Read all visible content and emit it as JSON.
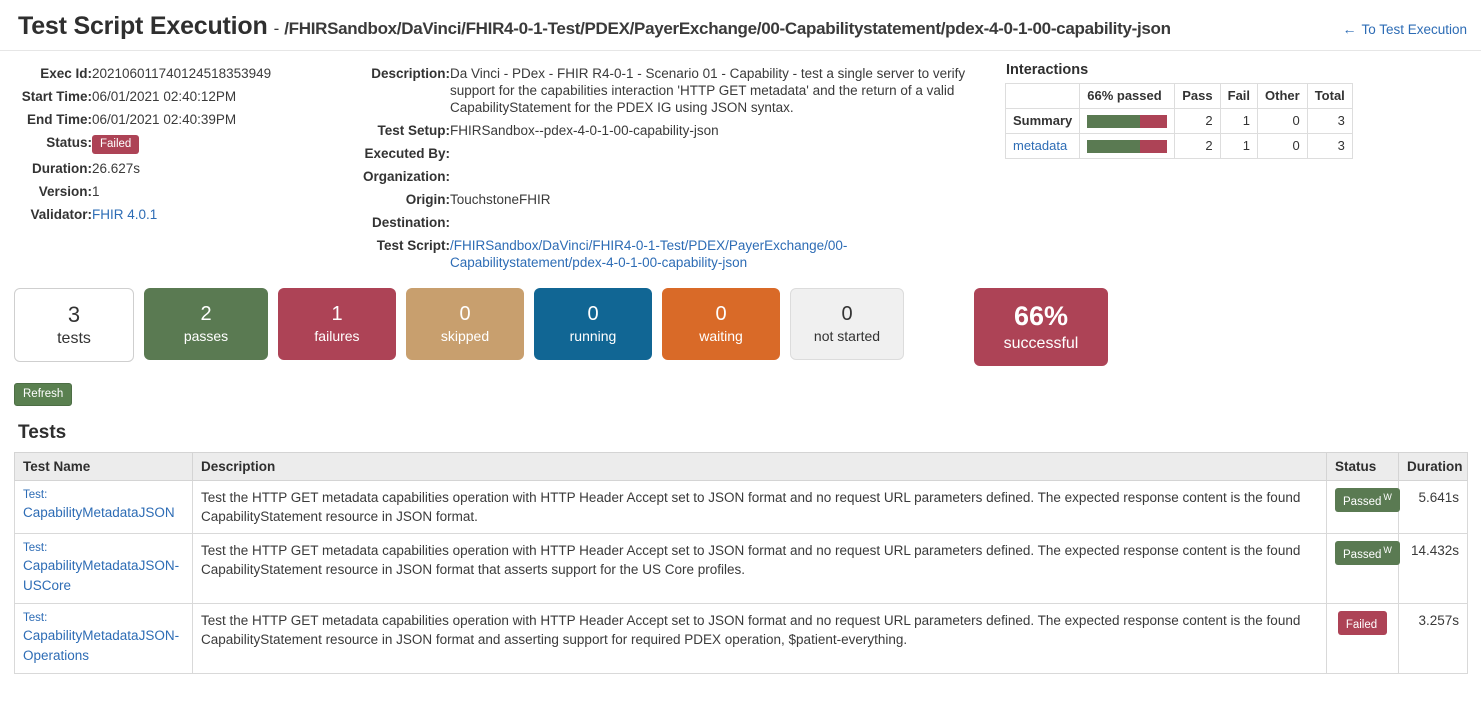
{
  "header": {
    "title": "Test Script Execution",
    "separator": "-",
    "path": "/FHIRSandbox/DaVinci/FHIR4-0-1-Test/PDEX/PayerExchange/00-Capabilitystatement/pdex-4-0-1-00-capability-json",
    "back_link": "To Test Execution",
    "back_arrow": "←"
  },
  "details": {
    "exec_id_label": "Exec Id:",
    "exec_id": "202106011740124518353949",
    "start_time_label": "Start Time:",
    "start_time": "06/01/2021 02:40:12PM",
    "end_time_label": "End Time:",
    "end_time": "06/01/2021 02:40:39PM",
    "status_label": "Status:",
    "status": "Failed",
    "duration_label": "Duration:",
    "duration": "26.627s",
    "version_label": "Version:",
    "version": "1",
    "validator_label": "Validator:",
    "validator": "FHIR 4.0.1"
  },
  "meta": {
    "description_label": "Description:",
    "description": "Da Vinci - PDex - FHIR R4-0-1 - Scenario 01 - Capability - test a single server to verify support for the capabilities interaction 'HTTP GET metadata' and the return of a valid CapabilityStatement for the PDEX IG using JSON syntax.",
    "test_setup_label": "Test Setup:",
    "test_setup": "FHIRSandbox--pdex-4-0-1-00-capability-json",
    "executed_by_label": "Executed By:",
    "executed_by": "",
    "organization_label": "Organization:",
    "organization": "",
    "origin_label": "Origin:",
    "origin": "TouchstoneFHIR",
    "destination_label": "Destination:",
    "destination": "",
    "test_script_label": "Test Script:",
    "test_script": "/FHIRSandbox/DaVinci/FHIR4-0-1-Test/PDEX/PayerExchange/00-Capabilitystatement/pdex-4-0-1-00-capability-json"
  },
  "interactions": {
    "title": "Interactions",
    "columns": [
      "",
      "66% passed",
      "Pass",
      "Fail",
      "Other",
      "Total"
    ],
    "rows": [
      {
        "label": "Summary",
        "is_link": false,
        "pass_pct": 66,
        "fail_pct": 34,
        "pass": "2",
        "fail": "1",
        "other": "0",
        "total": "3"
      },
      {
        "label": "metadata",
        "is_link": true,
        "pass_pct": 66,
        "fail_pct": 34,
        "pass": "2",
        "fail": "1",
        "other": "0",
        "total": "3"
      }
    ]
  },
  "tiles": [
    {
      "num": "3",
      "label": "tests"
    },
    {
      "num": "2",
      "label": "passes"
    },
    {
      "num": "1",
      "label": "failures"
    },
    {
      "num": "0",
      "label": "skipped"
    },
    {
      "num": "0",
      "label": "running"
    },
    {
      "num": "0",
      "label": "waiting"
    },
    {
      "num": "0",
      "label": "not started"
    },
    {
      "num": "66%",
      "label": "successful"
    }
  ],
  "actions": {
    "refresh_label": "Refresh"
  },
  "tests_section": {
    "title": "Tests",
    "columns": [
      "Test Name",
      "Description",
      "Status",
      "Duration"
    ],
    "rows": [
      {
        "kicker": "Test:",
        "name": "CapabilityMetadataJSON",
        "description": "Test the HTTP GET metadata capabilities operation with HTTP Header Accept set to JSON format and no request URL parameters defined. The expected response content is the found CapabilityStatement resource in JSON format.",
        "status": "Passed",
        "status_sup": "W",
        "status_kind": "passed",
        "duration": "5.641s"
      },
      {
        "kicker": "Test:",
        "name": "CapabilityMetadataJSON-USCore",
        "description": "Test the HTTP GET metadata capabilities operation with HTTP Header Accept set to JSON format and no request URL parameters defined. The expected response content is the found CapabilityStatement resource in JSON format that asserts support for the US Core profiles.",
        "status": "Passed",
        "status_sup": "W",
        "status_kind": "passed",
        "duration": "14.432s"
      },
      {
        "kicker": "Test:",
        "name": "CapabilityMetadataJSON-Operations",
        "description": "Test the HTTP GET metadata capabilities operation with HTTP Header Accept set to JSON format and no request URL parameters defined. The expected response content is the found CapabilityStatement resource in JSON format and asserting support for required PDEX operation, $patient-everything.",
        "status": "Failed",
        "status_sup": "",
        "status_kind": "failed",
        "duration": "3.257s"
      }
    ]
  },
  "colors": {
    "pass_green": "#5a7a52",
    "fail_crimson": "#ad4356",
    "skipped_tan": "#c89f6e",
    "running_blue": "#116694",
    "waiting_orange": "#d96a28",
    "link_blue": "#2d6cb5",
    "refresh_green": "#5a8050"
  }
}
